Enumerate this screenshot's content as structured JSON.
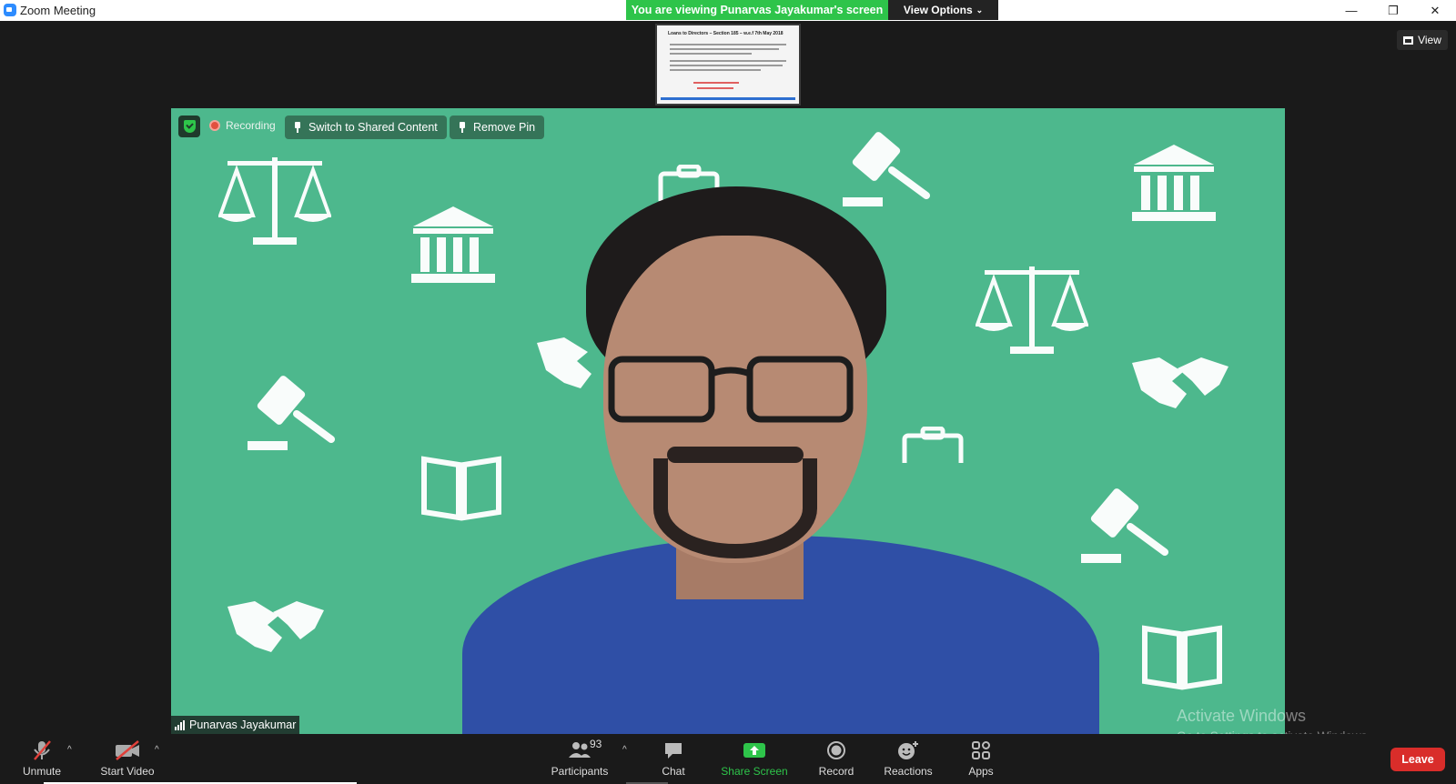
{
  "window": {
    "title": "Zoom Meeting",
    "minimize": "—",
    "restore": "❐",
    "close": "✕"
  },
  "banner": {
    "viewing_text": "You are viewing Punarvas Jayakumar's screen",
    "view_options_label": "View Options",
    "accent": "#2ec44a"
  },
  "thumbnail": {
    "title": "Loans to Directors – Section 185 – w.e.f 7th May 2018"
  },
  "view_button": {
    "label": "View"
  },
  "video": {
    "background_color": "#4db88d",
    "recording_label": "Recording",
    "switch_label": "Switch to Shared Content",
    "remove_pin_label": "Remove Pin",
    "participant_name": "Punarvas Jayakumar"
  },
  "watermark": {
    "line1": "Activate Windows",
    "line2": "Go to Settings to activate Windows."
  },
  "toolbar": {
    "unmute": "Unmute",
    "start_video": "Start Video",
    "participants": "Participants",
    "participants_count": "93",
    "chat": "Chat",
    "share_screen": "Share Screen",
    "record": "Record",
    "reactions": "Reactions",
    "apps": "Apps",
    "leave": "Leave",
    "share_color": "#2ec44a",
    "leave_color": "#d92d2a"
  }
}
